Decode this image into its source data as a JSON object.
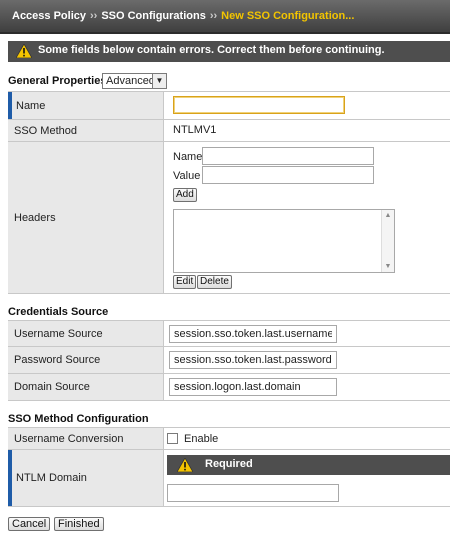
{
  "breadcrumb": {
    "items": [
      "Access Policy",
      "SSO Configurations",
      "New SSO Configuration..."
    ],
    "separator": "››"
  },
  "error_message": "Some fields below contain errors. Correct them before continuing.",
  "general_properties": {
    "label": "General Properties:",
    "selected": "Advanced"
  },
  "form": {
    "name_label": "Name",
    "name_value": "",
    "sso_method_label": "SSO Method",
    "sso_method_value": "NTLMV1",
    "headers_label": "Headers",
    "header_name_label": "Name",
    "header_value_label": "Value",
    "add_label": "Add",
    "edit_label": "Edit",
    "delete_label": "Delete"
  },
  "credentials": {
    "section_label": "Credentials Source",
    "username_label": "Username Source",
    "username_value": "session.sso.token.last.username",
    "password_label": "Password Source",
    "password_value": "session.sso.token.last.password",
    "domain_label": "Domain Source",
    "domain_value": "session.logon.last.domain"
  },
  "sso_method_config": {
    "section_label": "SSO Method Configuration",
    "username_conversion_label": "Username Conversion",
    "enable_label": "Enable",
    "ntlm_domain_label": "NTLM Domain",
    "required_label": "Required",
    "ntlm_domain_value": ""
  },
  "actions": {
    "cancel_label": "Cancel",
    "finished_label": "Finished"
  },
  "colors": {
    "breadcrumb_current": "#f2c400",
    "required_marker": "#1f5ca8",
    "warning": "#f5c400"
  }
}
